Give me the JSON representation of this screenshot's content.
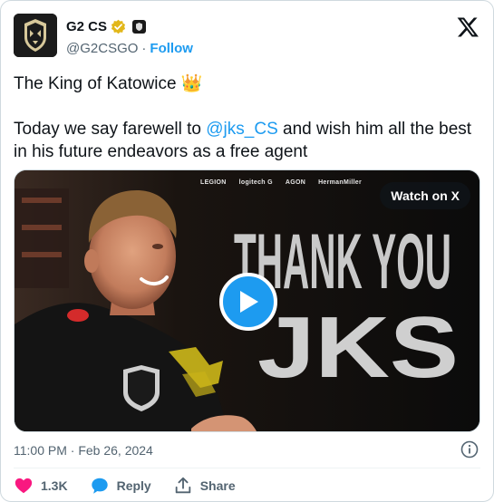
{
  "author": {
    "name": "G2 CS",
    "handle": "@G2CSGO",
    "separator": "·",
    "follow_label": "Follow"
  },
  "tweet": {
    "line1": "The King of Katowice 👑",
    "line2_prefix": "Today we say farewell to ",
    "mention": "@jks_CS",
    "line2_suffix": " and wish him all the best in his future endeavors as a free agent"
  },
  "media": {
    "watch_label": "Watch on X",
    "banner_line1": "THANK YOU",
    "banner_line2": "JKS",
    "sponsors": [
      "LEGION",
      "logitech G",
      "AGON",
      "HermanMiller"
    ]
  },
  "meta": {
    "timestamp": "11:00 PM · Feb 26, 2024"
  },
  "actions": {
    "like_count": "1.3K",
    "reply_label": "Reply",
    "share_label": "Share"
  },
  "colors": {
    "accent": "#1d9bf0",
    "like": "#f91880",
    "muted": "#536471",
    "verified_gold": "#e2b719"
  }
}
